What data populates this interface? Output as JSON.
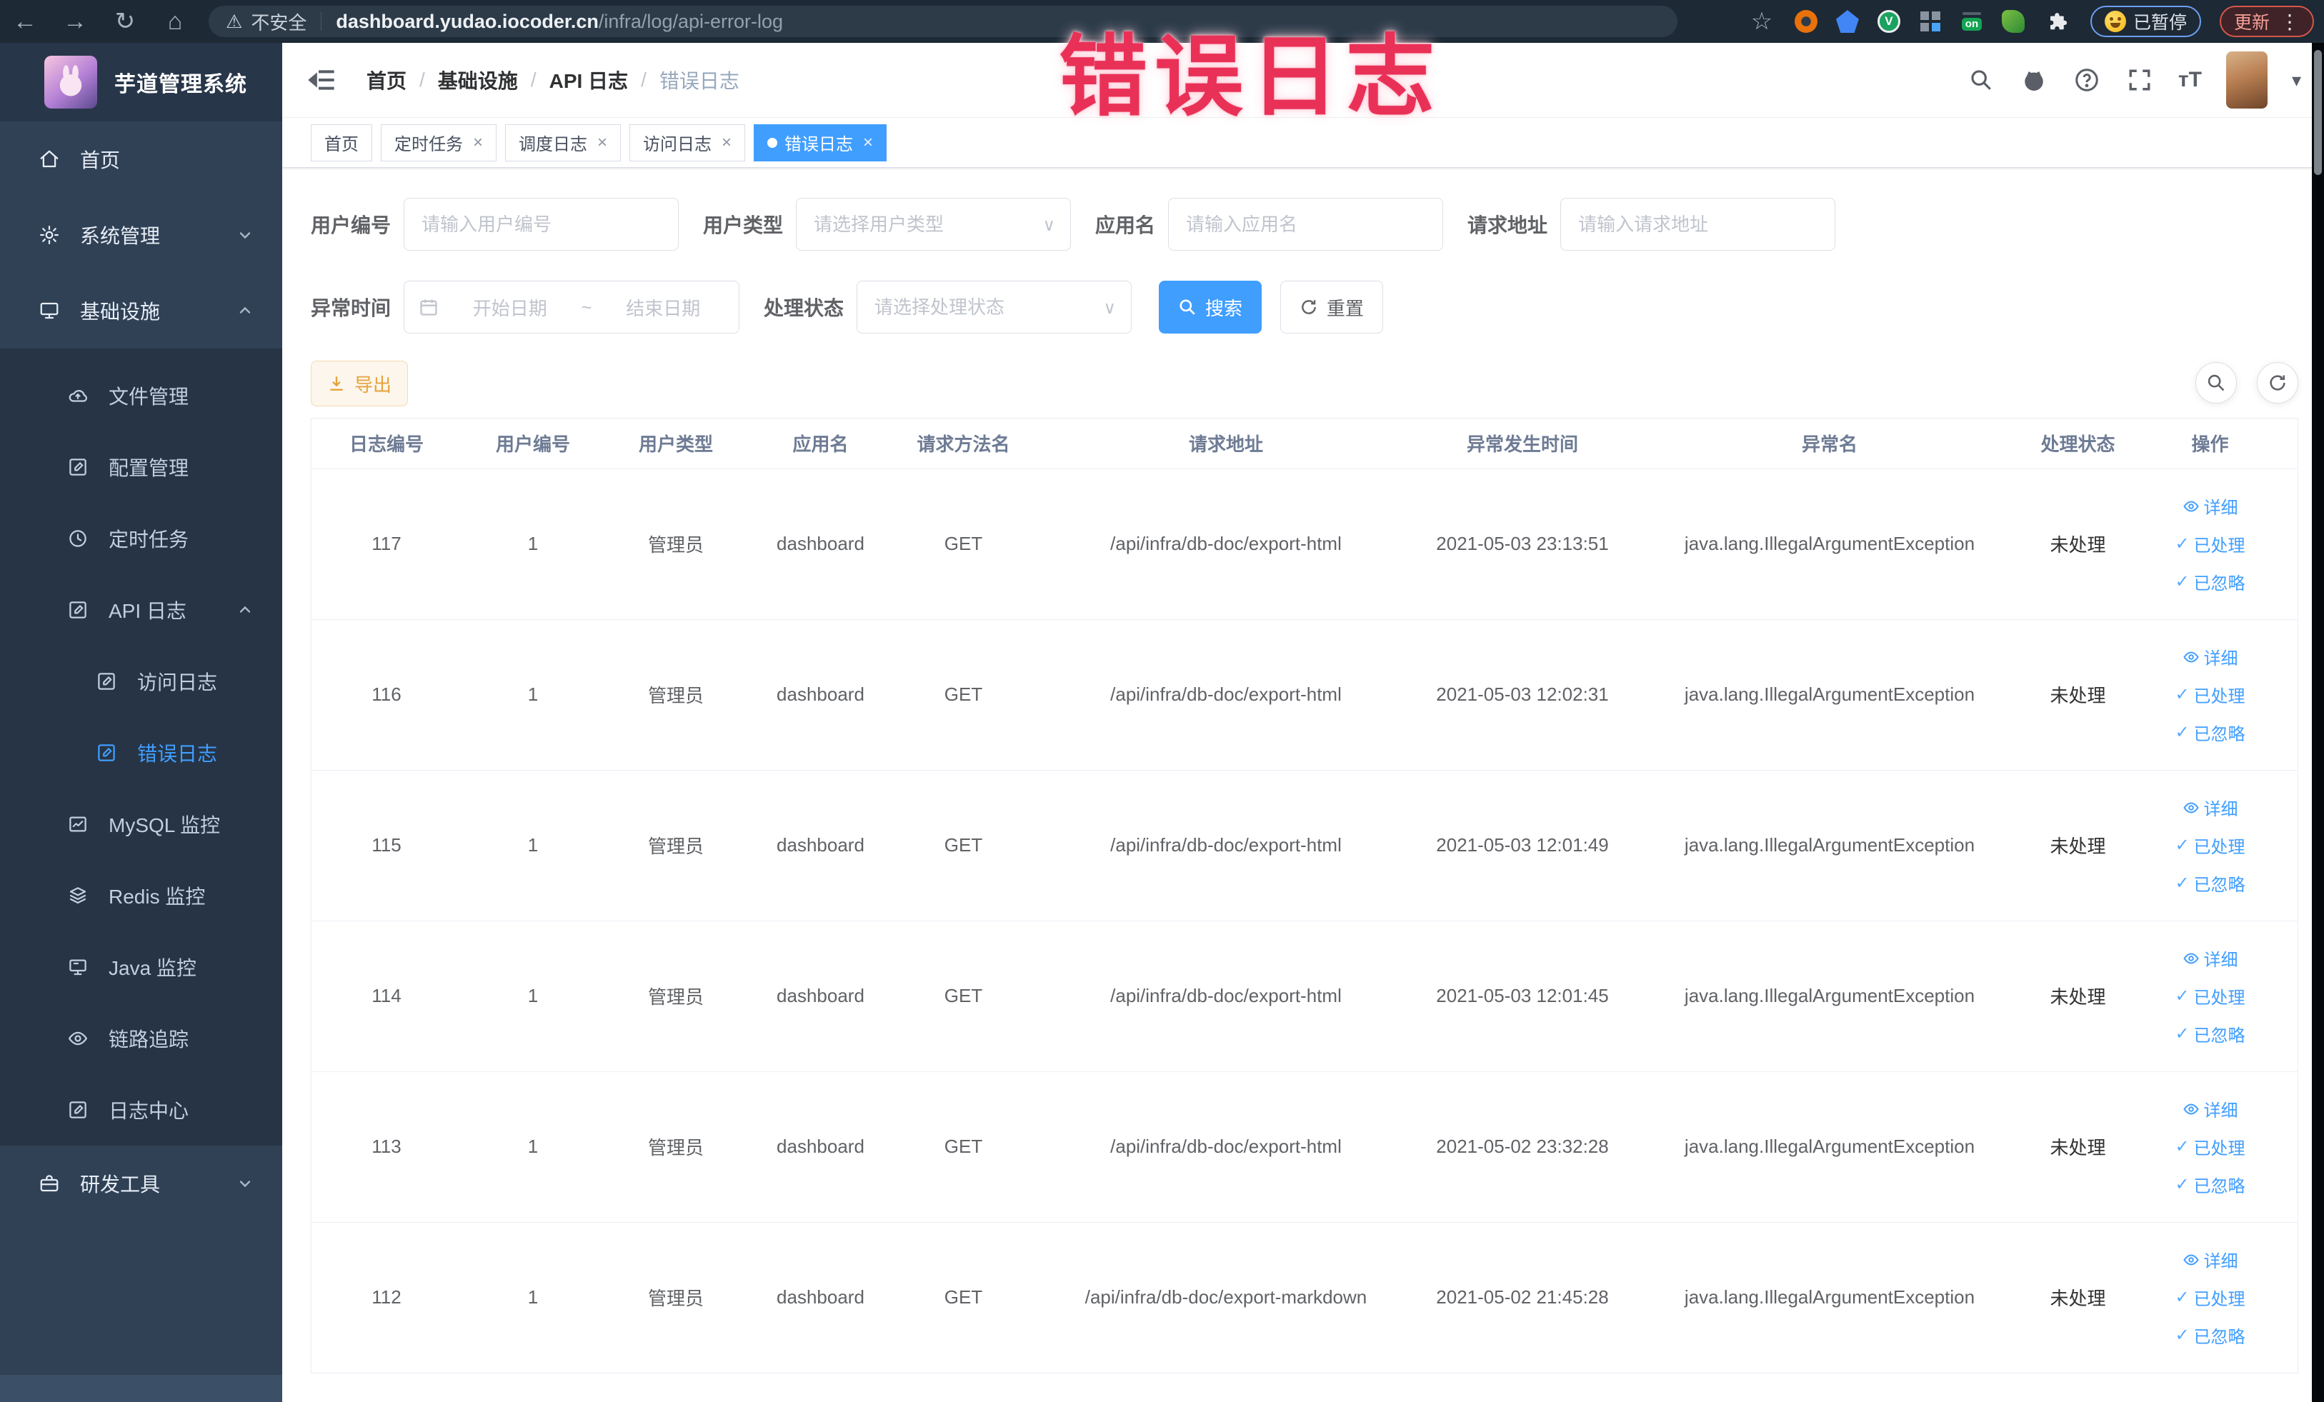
{
  "browser": {
    "security_label": "不安全",
    "url_host": "dashboard.yudao.iocoder.cn",
    "url_path": "/infra/log/api-error-log",
    "on_badge": "on",
    "green_ext_letter": "V",
    "paused_badge": "已暂停",
    "update_button": "更新"
  },
  "icons": {
    "back": "←",
    "forward": "→",
    "reload": "↻",
    "home": "⌂",
    "star": "☆",
    "warning": "⚠",
    "dots": "⋮",
    "caret_down": "▾",
    "close": "×",
    "select_caret": "∨",
    "fontsize": "тT",
    "tilde": "~"
  },
  "overlay": {
    "text": "错误日志",
    "color": "#e93157"
  },
  "sidebar": {
    "logo_title": "芋道管理系统",
    "menu": [
      {
        "key": "home",
        "label": "首页",
        "icon": "home-icon",
        "level": 0
      },
      {
        "key": "system-mgmt",
        "label": "系统管理",
        "icon": "gear-icon",
        "level": 0,
        "chevron": "down"
      },
      {
        "key": "infra",
        "label": "基础设施",
        "icon": "monitor-icon",
        "level": 0,
        "chevron": "up",
        "opensSub": true
      },
      {
        "key": "file-mgmt",
        "label": "文件管理",
        "icon": "cloud-icon",
        "level": 1
      },
      {
        "key": "config-mgmt",
        "label": "配置管理",
        "icon": "edit-square-icon",
        "level": 1
      },
      {
        "key": "cron-job",
        "label": "定时任务",
        "icon": "clock-icon",
        "level": 1
      },
      {
        "key": "api-log",
        "label": "API 日志",
        "icon": "edit-square-icon",
        "level": 1,
        "chevron": "up"
      },
      {
        "key": "access-log",
        "label": "访问日志",
        "icon": "edit-square-icon",
        "level": 2
      },
      {
        "key": "error-log",
        "label": "错误日志",
        "icon": "edit-square-icon",
        "level": 2,
        "active": true
      },
      {
        "key": "mysql",
        "label": "MySQL 监控",
        "icon": "chart-box-icon",
        "level": 1
      },
      {
        "key": "redis",
        "label": "Redis 监控",
        "icon": "layers-icon",
        "level": 1
      },
      {
        "key": "java",
        "label": "Java 监控",
        "icon": "screen-icon",
        "level": 1
      },
      {
        "key": "trace",
        "label": "链路追踪",
        "icon": "eye-icon",
        "level": 1
      },
      {
        "key": "log-center",
        "label": "日志中心",
        "icon": "edit-square-icon",
        "level": 1
      },
      {
        "key": "dev-tools",
        "label": "研发工具",
        "icon": "briefcase-icon",
        "level": 0,
        "chevron": "down",
        "section": "after-sub"
      }
    ]
  },
  "breadcrumb": [
    "首页",
    "基础设施",
    "API 日志",
    "错误日志"
  ],
  "tabs": [
    {
      "label": "首页",
      "closable": false,
      "active": false
    },
    {
      "label": "定时任务",
      "closable": true,
      "active": false
    },
    {
      "label": "调度日志",
      "closable": true,
      "active": false
    },
    {
      "label": "访问日志",
      "closable": true,
      "active": false
    },
    {
      "label": "错误日志",
      "closable": true,
      "active": true
    }
  ],
  "filters": {
    "user_id": {
      "label": "用户编号",
      "placeholder": "请输入用户编号",
      "value": ""
    },
    "user_type": {
      "label": "用户类型",
      "placeholder": "请选择用户类型",
      "value": ""
    },
    "app_name": {
      "label": "应用名",
      "placeholder": "请输入应用名",
      "value": ""
    },
    "request_url": {
      "label": "请求地址",
      "placeholder": "请输入请求地址",
      "value": ""
    },
    "exception_time": {
      "label": "异常时间",
      "start_placeholder": "开始日期",
      "separator": "~",
      "end_placeholder": "结束日期"
    },
    "process_status": {
      "label": "处理状态",
      "placeholder": "请选择处理状态",
      "value": ""
    },
    "search_button": "搜索",
    "reset_button": "重置"
  },
  "toolbar": {
    "export_button": "导出"
  },
  "table": {
    "columns": [
      "日志编号",
      "用户编号",
      "用户类型",
      "应用名",
      "请求方法名",
      "请求地址",
      "异常发生时间",
      "异常名",
      "处理状态",
      "操作"
    ],
    "column_keys": [
      "log_id",
      "user_id",
      "user_type",
      "app_name",
      "method",
      "url",
      "time",
      "exception",
      "status",
      "ops"
    ],
    "rows": [
      [
        "117",
        "1",
        "管理员",
        "dashboard",
        "GET",
        "/api/infra/db-doc/export-html",
        "2021-05-03 23:13:51",
        "java.lang.IllegalArgumentException",
        "未处理"
      ],
      [
        "116",
        "1",
        "管理员",
        "dashboard",
        "GET",
        "/api/infra/db-doc/export-html",
        "2021-05-03 12:02:31",
        "java.lang.IllegalArgumentException",
        "未处理"
      ],
      [
        "115",
        "1",
        "管理员",
        "dashboard",
        "GET",
        "/api/infra/db-doc/export-html",
        "2021-05-03 12:01:49",
        "java.lang.IllegalArgumentException",
        "未处理"
      ],
      [
        "114",
        "1",
        "管理员",
        "dashboard",
        "GET",
        "/api/infra/db-doc/export-html",
        "2021-05-03 12:01:45",
        "java.lang.IllegalArgumentException",
        "未处理"
      ],
      [
        "113",
        "1",
        "管理员",
        "dashboard",
        "GET",
        "/api/infra/db-doc/export-html",
        "2021-05-02 23:32:28",
        "java.lang.IllegalArgumentException",
        "未处理"
      ],
      [
        "112",
        "1",
        "管理员",
        "dashboard",
        "GET",
        "/api/infra/db-doc/export-markdown",
        "2021-05-02 21:45:28",
        "java.lang.IllegalArgumentException",
        "未处理"
      ]
    ],
    "row_actions": [
      "详细",
      "已处理",
      "已忽略"
    ]
  },
  "ui_colors": {
    "accent": "#409eff",
    "warning": "#e6a23c",
    "sidebar_bg": "#304156",
    "sidebar_submenu_bg": "#263445",
    "chrome_bg": "#1d2935",
    "overlay_red": "#e93157"
  }
}
